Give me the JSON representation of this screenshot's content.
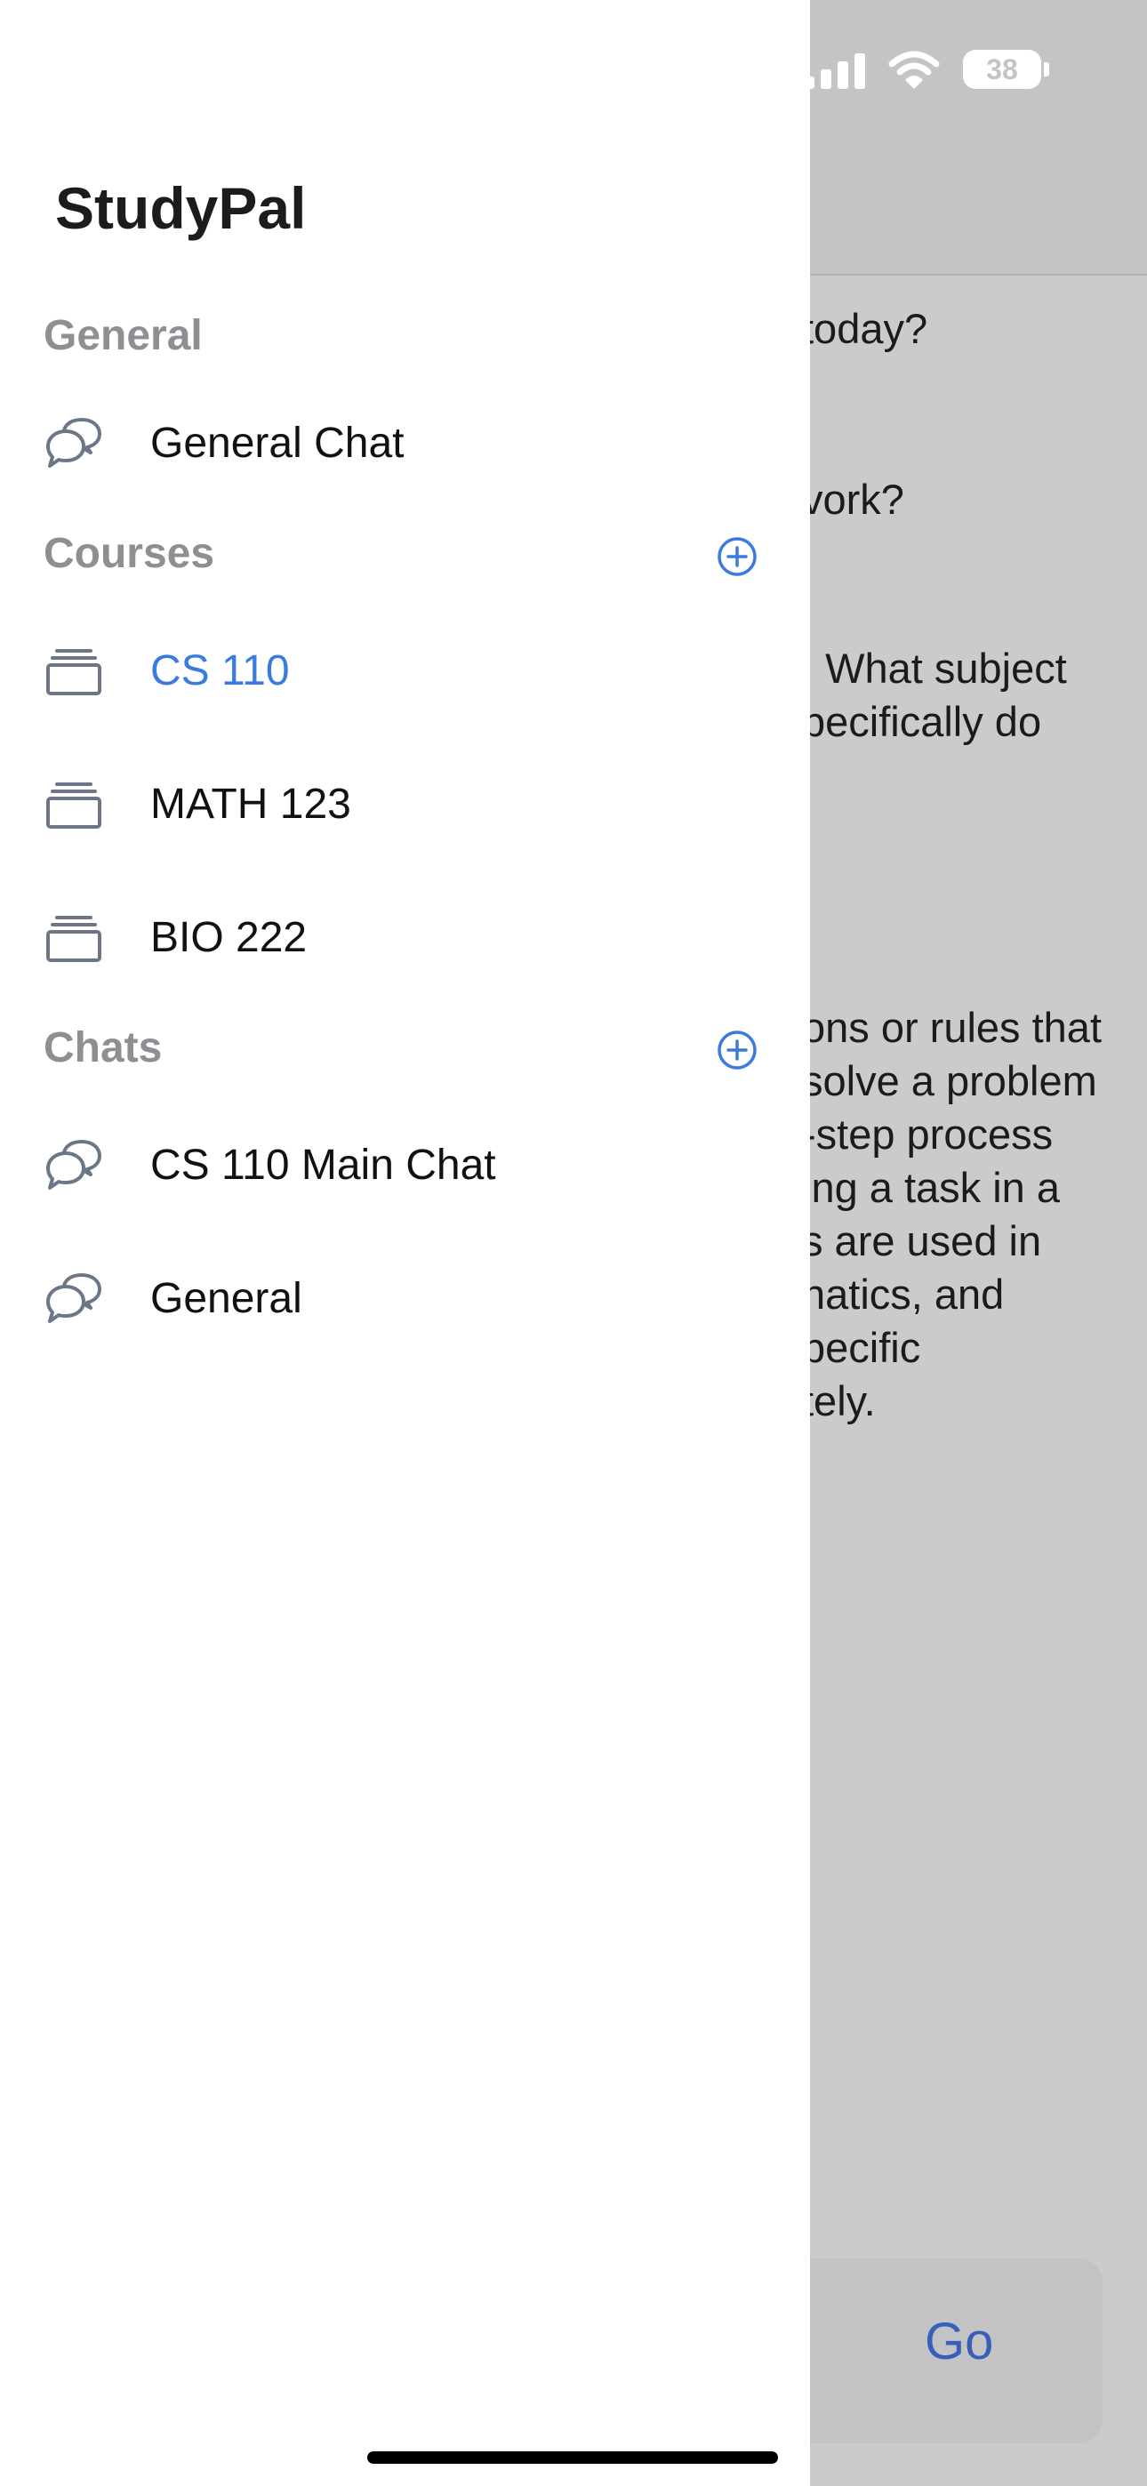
{
  "app": {
    "title": "StudyPal"
  },
  "status_bar": {
    "battery": "38"
  },
  "sections": {
    "general": {
      "title": "General",
      "items": [
        {
          "label": "General Chat",
          "icon": "chat-bubbles-icon"
        }
      ]
    },
    "courses": {
      "title": "Courses",
      "add_icon": "plus-circle-icon",
      "items": [
        {
          "label": "CS 110",
          "icon": "stack-icon",
          "selected": true
        },
        {
          "label": "MATH 123",
          "icon": "stack-icon"
        },
        {
          "label": "BIO 222",
          "icon": "stack-icon"
        }
      ]
    },
    "chats": {
      "title": "Chats",
      "add_icon": "plus-circle-icon",
      "items": [
        {
          "label": "CS 110 Main Chat",
          "icon": "chat-bubbles-icon"
        },
        {
          "label": "General",
          "icon": "chat-bubbles-icon"
        }
      ]
    }
  },
  "background": {
    "lines": [
      "today?",
      "vork?",
      ". What subject",
      "pecifically do",
      "ons or rules that",
      "solve a problem",
      "-step process",
      "ing a task in a",
      "s are used in",
      "natics, and",
      "pecific",
      "tely."
    ],
    "send_label": "Go"
  },
  "colors": {
    "accent": "#3b7ae0",
    "section_header": "#8e8e93",
    "icon": "#6b7787"
  }
}
